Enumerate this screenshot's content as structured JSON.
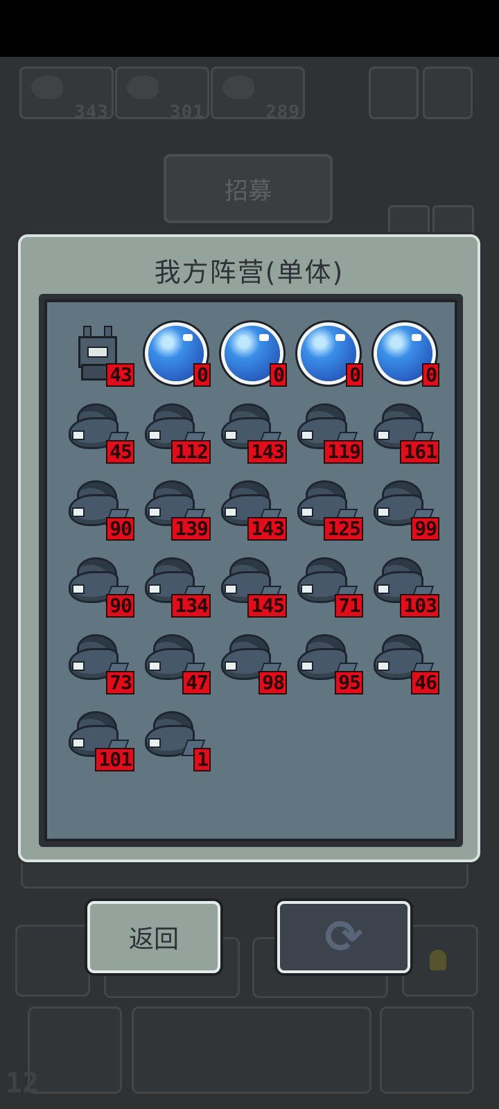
{
  "background": {
    "resources": [
      {
        "value": "343",
        "icon": "fish-icon"
      },
      {
        "value": "301",
        "icon": "fish-icon"
      },
      {
        "value": "289",
        "icon": "fish-icon"
      }
    ],
    "recruit_label": "招募",
    "level_text": "12"
  },
  "modal": {
    "title": "我方阵营(单体)",
    "units": [
      {
        "type": "leader",
        "count": "43"
      },
      {
        "type": "orb",
        "count": "0"
      },
      {
        "type": "orb",
        "count": "0"
      },
      {
        "type": "orb",
        "count": "0"
      },
      {
        "type": "orb",
        "count": "0"
      },
      {
        "type": "fish",
        "count": "45"
      },
      {
        "type": "fish",
        "count": "112"
      },
      {
        "type": "fish",
        "count": "143"
      },
      {
        "type": "fish",
        "count": "119"
      },
      {
        "type": "fish",
        "count": "161"
      },
      {
        "type": "fish",
        "count": "90"
      },
      {
        "type": "fish",
        "count": "139"
      },
      {
        "type": "fish",
        "count": "143"
      },
      {
        "type": "fish",
        "count": "125"
      },
      {
        "type": "fish",
        "count": "99"
      },
      {
        "type": "fish",
        "count": "90"
      },
      {
        "type": "fish",
        "count": "134"
      },
      {
        "type": "fish",
        "count": "145"
      },
      {
        "type": "fish",
        "count": "71"
      },
      {
        "type": "fish",
        "count": "103"
      },
      {
        "type": "fish",
        "count": "73"
      },
      {
        "type": "fish",
        "count": "47"
      },
      {
        "type": "fish",
        "count": "98"
      },
      {
        "type": "fish",
        "count": "95"
      },
      {
        "type": "fish",
        "count": "46"
      },
      {
        "type": "fish",
        "count": "101"
      },
      {
        "type": "fish",
        "count": "1"
      }
    ]
  },
  "buttons": {
    "back_label": "返回",
    "refresh_icon": "refresh-icon",
    "refresh_glyph": "⟳"
  },
  "colors": {
    "badge": "#e10d1b",
    "panel": "#94a49d",
    "inner": "#617680"
  }
}
